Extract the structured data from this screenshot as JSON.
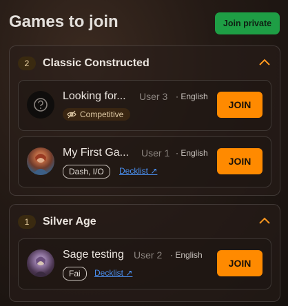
{
  "header": {
    "title": "Games to join",
    "join_private_label": "Join private"
  },
  "groups": [
    {
      "count": "2",
      "title": "Classic Constructed",
      "games": [
        {
          "name": "Looking for...",
          "user": "User 3",
          "language": "· English",
          "tag": "Competitive",
          "join_label": "JOIN"
        },
        {
          "name": "My First Ga...",
          "user": "User 1",
          "language": "· English",
          "tag": "Dash, I/O",
          "decklist_label": "Decklist ↗",
          "join_label": "JOIN"
        }
      ]
    },
    {
      "count": "1",
      "title": "Silver Age",
      "games": [
        {
          "name": "Sage testing",
          "user": "User 2",
          "language": "· English",
          "tag": "Fai",
          "decklist_label": "Decklist ↗",
          "join_label": "JOIN"
        }
      ]
    }
  ],
  "icons": {
    "unknown_avatar": "question-circle-icon",
    "competitive": "eye-off-icon",
    "collapse": "chevron-up-icon"
  },
  "colors": {
    "join_private_bg": "#1e9e45",
    "join_bg": "#ff8a00",
    "collapse_chevron": "#ff9a1f",
    "link": "#4a8ff0"
  }
}
